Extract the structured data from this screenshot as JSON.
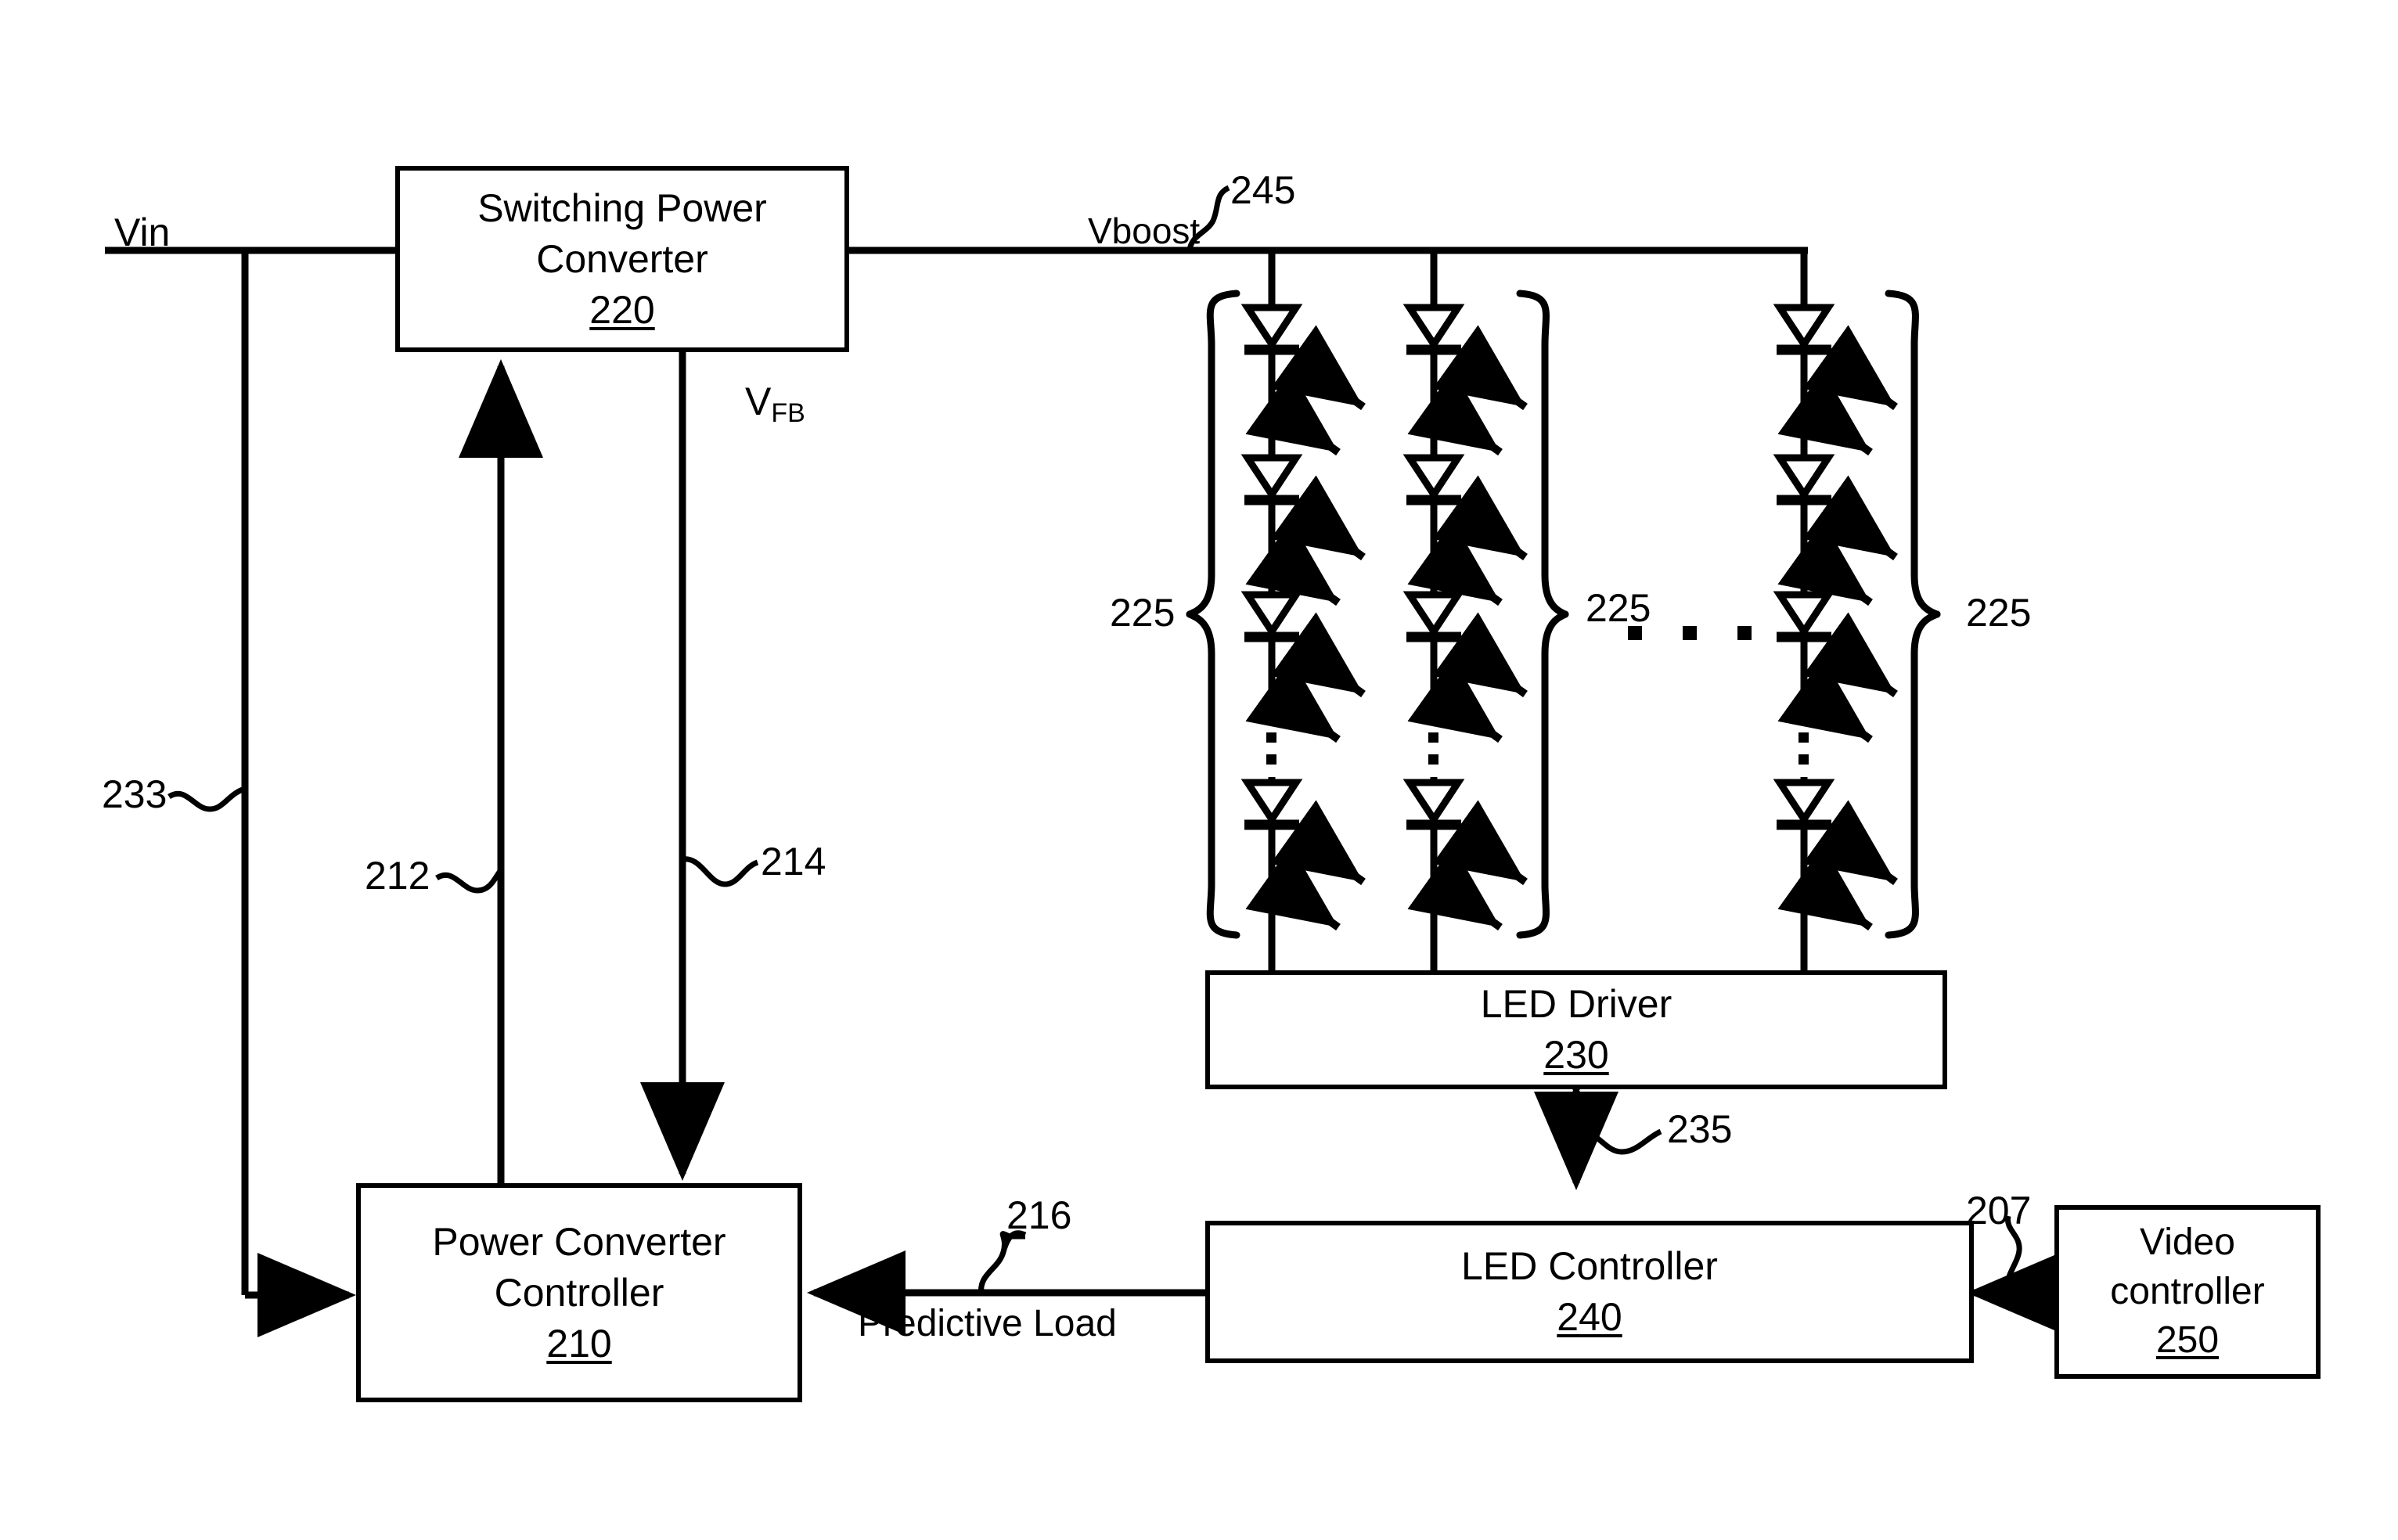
{
  "figure": {
    "domain": "patent-block-diagram",
    "line_color": "#000000",
    "background_color": "#ffffff"
  },
  "blocks": {
    "switching_power_converter": {
      "line1": "Switching Power",
      "line2": "Converter",
      "ref": "220"
    },
    "power_converter_controller": {
      "line1": "Power Converter",
      "line2": "Controller",
      "ref": "210"
    },
    "led_driver": {
      "line1": "LED Driver",
      "ref": "230"
    },
    "led_controller": {
      "line1": "LED Controller",
      "ref": "240"
    },
    "video_controller": {
      "line1": "Video",
      "line2": "controller",
      "ref": "250"
    }
  },
  "signals": {
    "vin": "Vin",
    "vboost": "Vboost",
    "vfb_base": "V",
    "vfb_sub": "FB",
    "predictive_load": "Predictive Load"
  },
  "reference_numerals": {
    "input_rail": "233",
    "control_signal": "212",
    "feedback_signal": "214",
    "predictive_load_signal": "216",
    "led_driver_link": "235",
    "video_link": "207",
    "boost_rail": "245",
    "led_string_left": "225",
    "led_string_middle": "225",
    "led_string_right": "225"
  },
  "led_strings": {
    "count_shown": 3,
    "leds_per_string": 4,
    "vertical_ellipsis": "⋮",
    "horizontal_ellipsis": "▪ ▪ ▪"
  }
}
